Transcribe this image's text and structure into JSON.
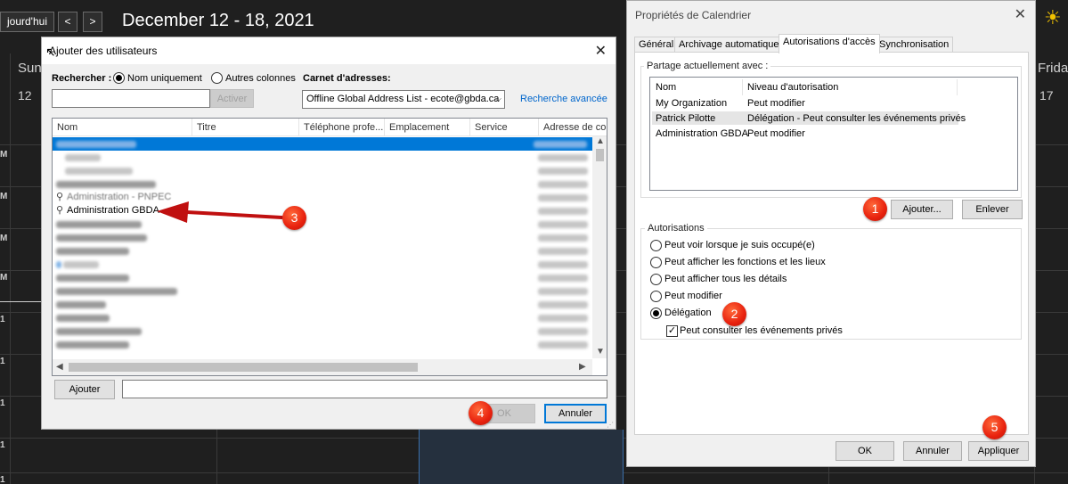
{
  "calendar": {
    "today_btn": "jourd'hui",
    "prev_icon": "chevron-left-icon",
    "next_icon": "chevron-right-icon",
    "prev_glyph": "<",
    "next_glyph": ">",
    "title": "December 12 - 18, 2021",
    "sun_glyph": "☀",
    "day_sunday": "Sun",
    "day_sunday_num": "12",
    "day_friday": "Frida",
    "day_friday_num": "17",
    "time_labels": [
      "M",
      "M",
      "M",
      "M",
      "1",
      "1",
      "1",
      "1",
      "1"
    ]
  },
  "add_users": {
    "title": "Ajouter des utilisateurs",
    "close_glyph": "✕",
    "search_label": "Rechercher :",
    "radio_name_only": "Nom uniquement",
    "radio_other_cols": "Autres colonnes",
    "address_book_label": "Carnet d'adresses:",
    "search_value": "",
    "activate_btn": "Activer",
    "address_book_value": "Offline Global Address List - ecote@gbda.ca",
    "advanced_search": "Recherche avancée",
    "columns": [
      "Nom",
      "Titre",
      "Téléphone profe...",
      "Emplacement",
      "Service",
      "Adresse de cou"
    ],
    "visible_rows": [
      {
        "name": "Administration - PNPEC",
        "icon": "person-icon"
      },
      {
        "name": "Administration GBDA",
        "icon": "person-icon"
      }
    ],
    "add_btn": "Ajouter",
    "add_value": "",
    "ok_btn": "OK",
    "cancel_btn": "Annuler"
  },
  "properties": {
    "title": "Propriétés de Calendrier",
    "close_glyph": "✕",
    "tabs": [
      "Général",
      "Archivage automatique",
      "Autorisations d'accès",
      "Synchronisation"
    ],
    "active_tab": "Autorisations d'accès",
    "shared_with_label": "Partage actuellement avec :",
    "list_headers": [
      "Nom",
      "Niveau d'autorisation"
    ],
    "list_rows": [
      {
        "name": "My Organization",
        "level": "Peut modifier"
      },
      {
        "name": "Patrick Pilotte",
        "level": "Délégation - Peut consulter les événements privés"
      },
      {
        "name": "Administration GBDA",
        "level": "Peut modifier"
      }
    ],
    "add_btn": "Ajouter...",
    "remove_btn": "Enlever",
    "permissions_label": "Autorisations",
    "options": [
      "Peut voir lorsque je suis occupé(e)",
      "Peut afficher les fonctions et les lieux",
      "Peut afficher tous les détails",
      "Peut modifier",
      "Délégation"
    ],
    "selected_option": "Délégation",
    "private_checkbox": "Peut consulter les événements privés",
    "private_checked": true,
    "check_glyph": "✓",
    "ok_btn": "OK",
    "cancel_btn": "Annuler",
    "apply_btn": "Appliquer"
  },
  "markers": [
    "1",
    "2",
    "3",
    "4",
    "5"
  ],
  "colors": {
    "marker": "#e8210e",
    "selection": "#0078d7",
    "calendar_bg": "#1f1f1f"
  }
}
